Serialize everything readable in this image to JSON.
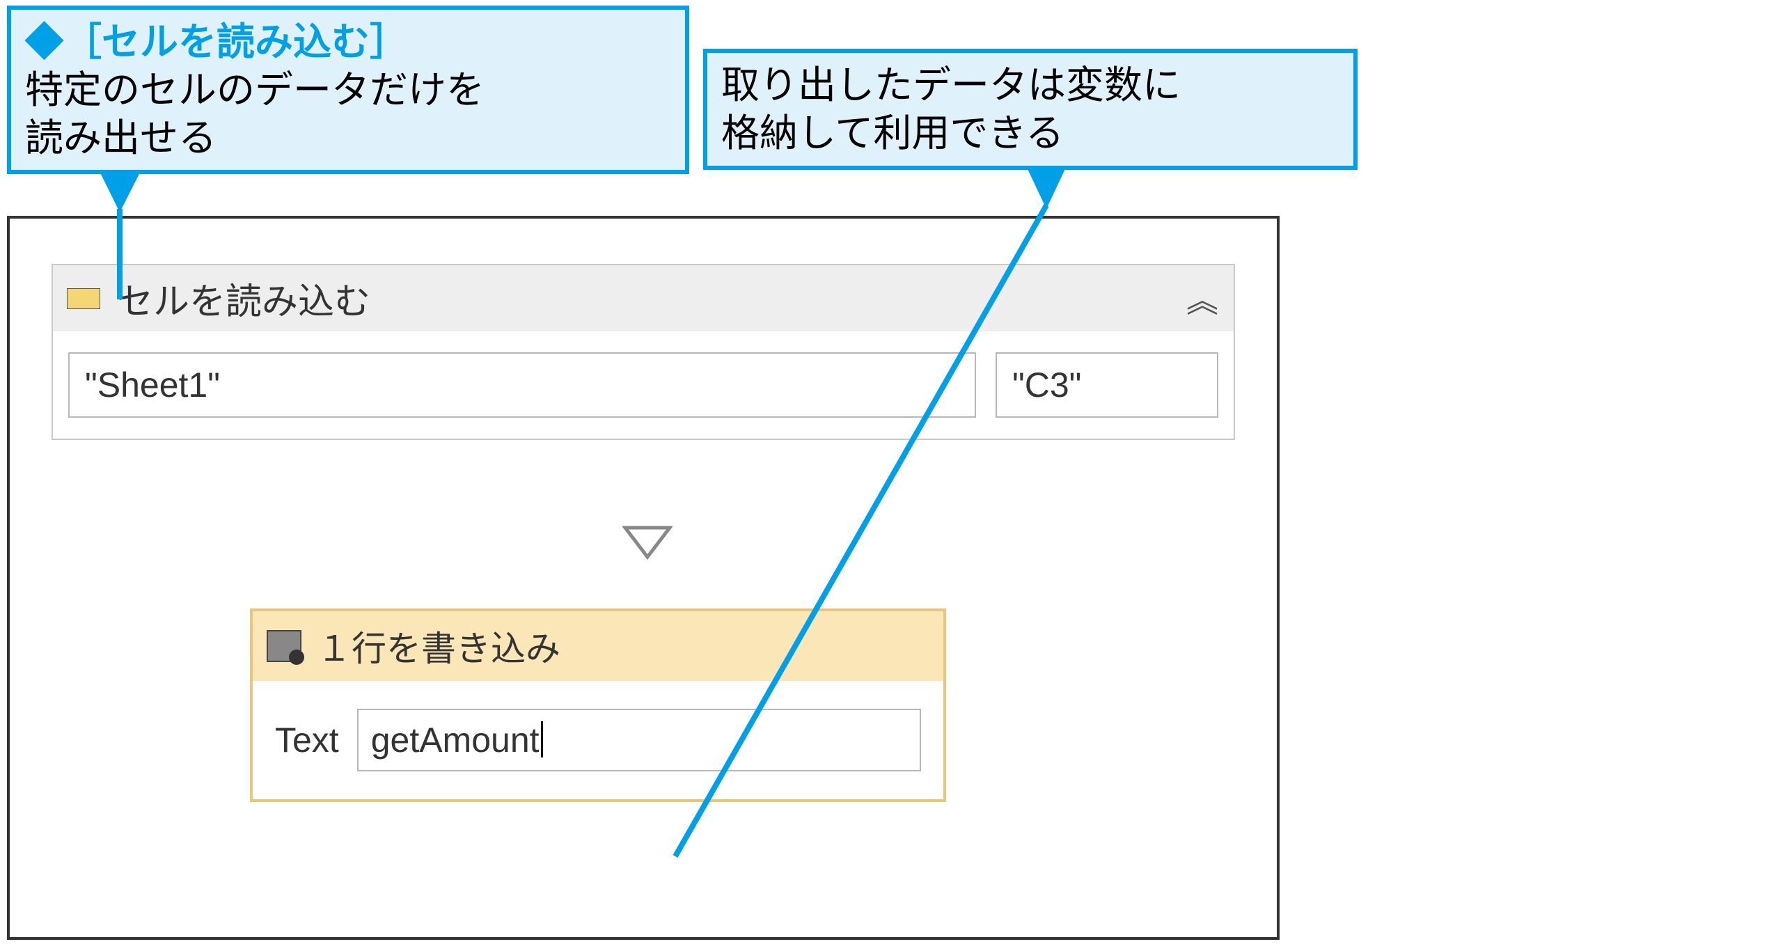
{
  "callouts": {
    "left": {
      "title": "◆［セルを読み込む］",
      "body": "特定のセルのデータだけを\n読み出せる"
    },
    "right": {
      "body": "取り出したデータは変数に\n格納して利用できる"
    }
  },
  "activity_readcell": {
    "title": "セルを読み込む",
    "sheet_value": "\"Sheet1\"",
    "cell_value": "\"C3\""
  },
  "activity_writeline": {
    "title": "１行を書き込み",
    "text_label": "Text",
    "text_value": "getAmount"
  }
}
